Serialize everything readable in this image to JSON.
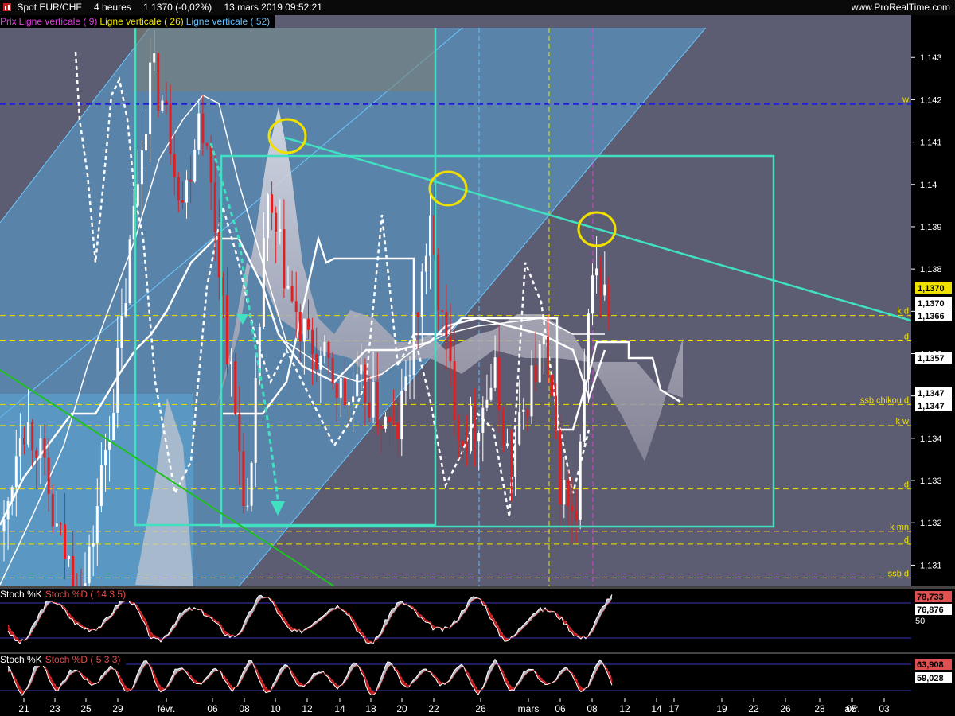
{
  "header": {
    "instrument": "Spot EUR/CHF",
    "timeframe": "4 heures",
    "quote": "1,1370 (-0,02%)",
    "datetime": "13 mars 2019 09:52:21",
    "site": "www.ProRealTime.com"
  },
  "legend": [
    {
      "label": "Prix",
      "color": "#e040e0"
    },
    {
      "label": "Ligne verticale ( 9)",
      "color": "#e040e0"
    },
    {
      "label": "Ligne verticale ( 26)",
      "color": "#f0e000"
    },
    {
      "label": "Ligne verticale ( 52)",
      "color": "#60c0ff"
    }
  ],
  "chart_data": [
    {
      "type": "line",
      "name": "price-panel",
      "y_ticks": [
        "1,143",
        "1,142",
        "1,141",
        "1,14",
        "1,139",
        "1,138",
        "1,137",
        "1,136",
        "1,135",
        "1,134",
        "1,133",
        "1,132",
        "1,131"
      ],
      "ylim": [
        1.1305,
        1.1437
      ],
      "x_ticks": [
        "21",
        "23",
        "25",
        "29",
        "févr.",
        "06",
        "08",
        "10",
        "12",
        "14",
        "18",
        "20",
        "22",
        "26",
        "mars",
        "06",
        "08",
        "12",
        "14",
        "17",
        "19",
        "22",
        "26",
        "28",
        "avr.",
        "03",
        "05"
      ],
      "x": [
        "21",
        "22",
        "23",
        "24",
        "25",
        "28",
        "29",
        "30",
        "31",
        "févr.",
        "04",
        "05",
        "06",
        "07",
        "08",
        "11",
        "12",
        "13",
        "14",
        "15",
        "18",
        "19",
        "20",
        "21",
        "22",
        "25",
        "26",
        "27",
        "28",
        "mars",
        "04",
        "05",
        "06",
        "07",
        "08",
        "11",
        "12",
        "13"
      ],
      "series": [
        {
          "values": [
            1.1318,
            1.1345,
            1.134,
            1.132,
            1.131,
            1.1305,
            1.1332,
            1.1358,
            1.1395,
            1.1428,
            1.1415,
            1.1395,
            1.142,
            1.1388,
            1.135,
            1.1318,
            1.1395,
            1.1382,
            1.1365,
            1.136,
            1.1355,
            1.1348,
            1.1352,
            1.1345,
            1.134,
            1.1362,
            1.139,
            1.1362,
            1.134,
            1.1345,
            1.1355,
            1.1332,
            1.135,
            1.1362,
            1.133,
            1.1318,
            1.1382,
            1.137
          ]
        }
      ],
      "levels": [
        {
          "label": "w",
          "value": 1.1419,
          "color": "#2020d0"
        },
        {
          "label": "k d",
          "value": 1.1369,
          "color": "#f0e000"
        },
        {
          "label": "d",
          "value": 1.1363,
          "color": "#f0e000"
        },
        {
          "label": "ssb chikou d",
          "value": 1.1348,
          "color": "#f0e000"
        },
        {
          "label": "k w",
          "value": 1.1343,
          "color": "#f0e000"
        },
        {
          "label": "d",
          "value": 1.1328,
          "color": "#f0e000"
        },
        {
          "label": "k mn",
          "value": 1.1318,
          "color": "#f0e000"
        },
        {
          "label": "d",
          "value": 1.1315,
          "color": "#f0e000"
        },
        {
          "label": "ssb d",
          "value": 1.1307,
          "color": "#f0e000"
        }
      ],
      "price_tags": [
        {
          "text": "1,1370",
          "color": "#f0e000"
        },
        {
          "text": "1,1370",
          "color": "#000000"
        },
        {
          "text": "1,1366",
          "color": "#000000"
        },
        {
          "text": "1,1357",
          "color": "#000000"
        },
        {
          "text": "1,1347",
          "color": "#000000"
        },
        {
          "text": "1,1347",
          "color": "#000000"
        }
      ]
    },
    {
      "type": "line",
      "name": "stoch-1",
      "legend": [
        "Stoch %K",
        "Stoch %D ( 14 3 5)"
      ],
      "y_ticks": [
        "50"
      ],
      "ylim": [
        0,
        100
      ],
      "values": [
        78.733,
        76.876
      ],
      "value_tags": [
        {
          "text": "78,733",
          "color": "#e05050"
        },
        {
          "text": "76,876",
          "color": "#000000"
        }
      ]
    },
    {
      "type": "line",
      "name": "stoch-2",
      "legend": [
        "Stoch %K",
        "Stoch %D ( 5 3 3)"
      ],
      "ylim": [
        0,
        100
      ],
      "values": [
        63.908,
        59.028
      ],
      "value_tags": [
        {
          "text": "63,908",
          "color": "#e05050"
        },
        {
          "text": "59,028",
          "color": "#000000"
        }
      ]
    }
  ],
  "colors": {
    "background": "#5c5c72",
    "cloud": "#c8c8d0",
    "box": "#40e0c0",
    "trendline": "#40e0c0",
    "circle": "#f0e000",
    "bear_candle": "#e02020",
    "stoch_k": "#ffffff",
    "stoch_d": "#e04040"
  }
}
